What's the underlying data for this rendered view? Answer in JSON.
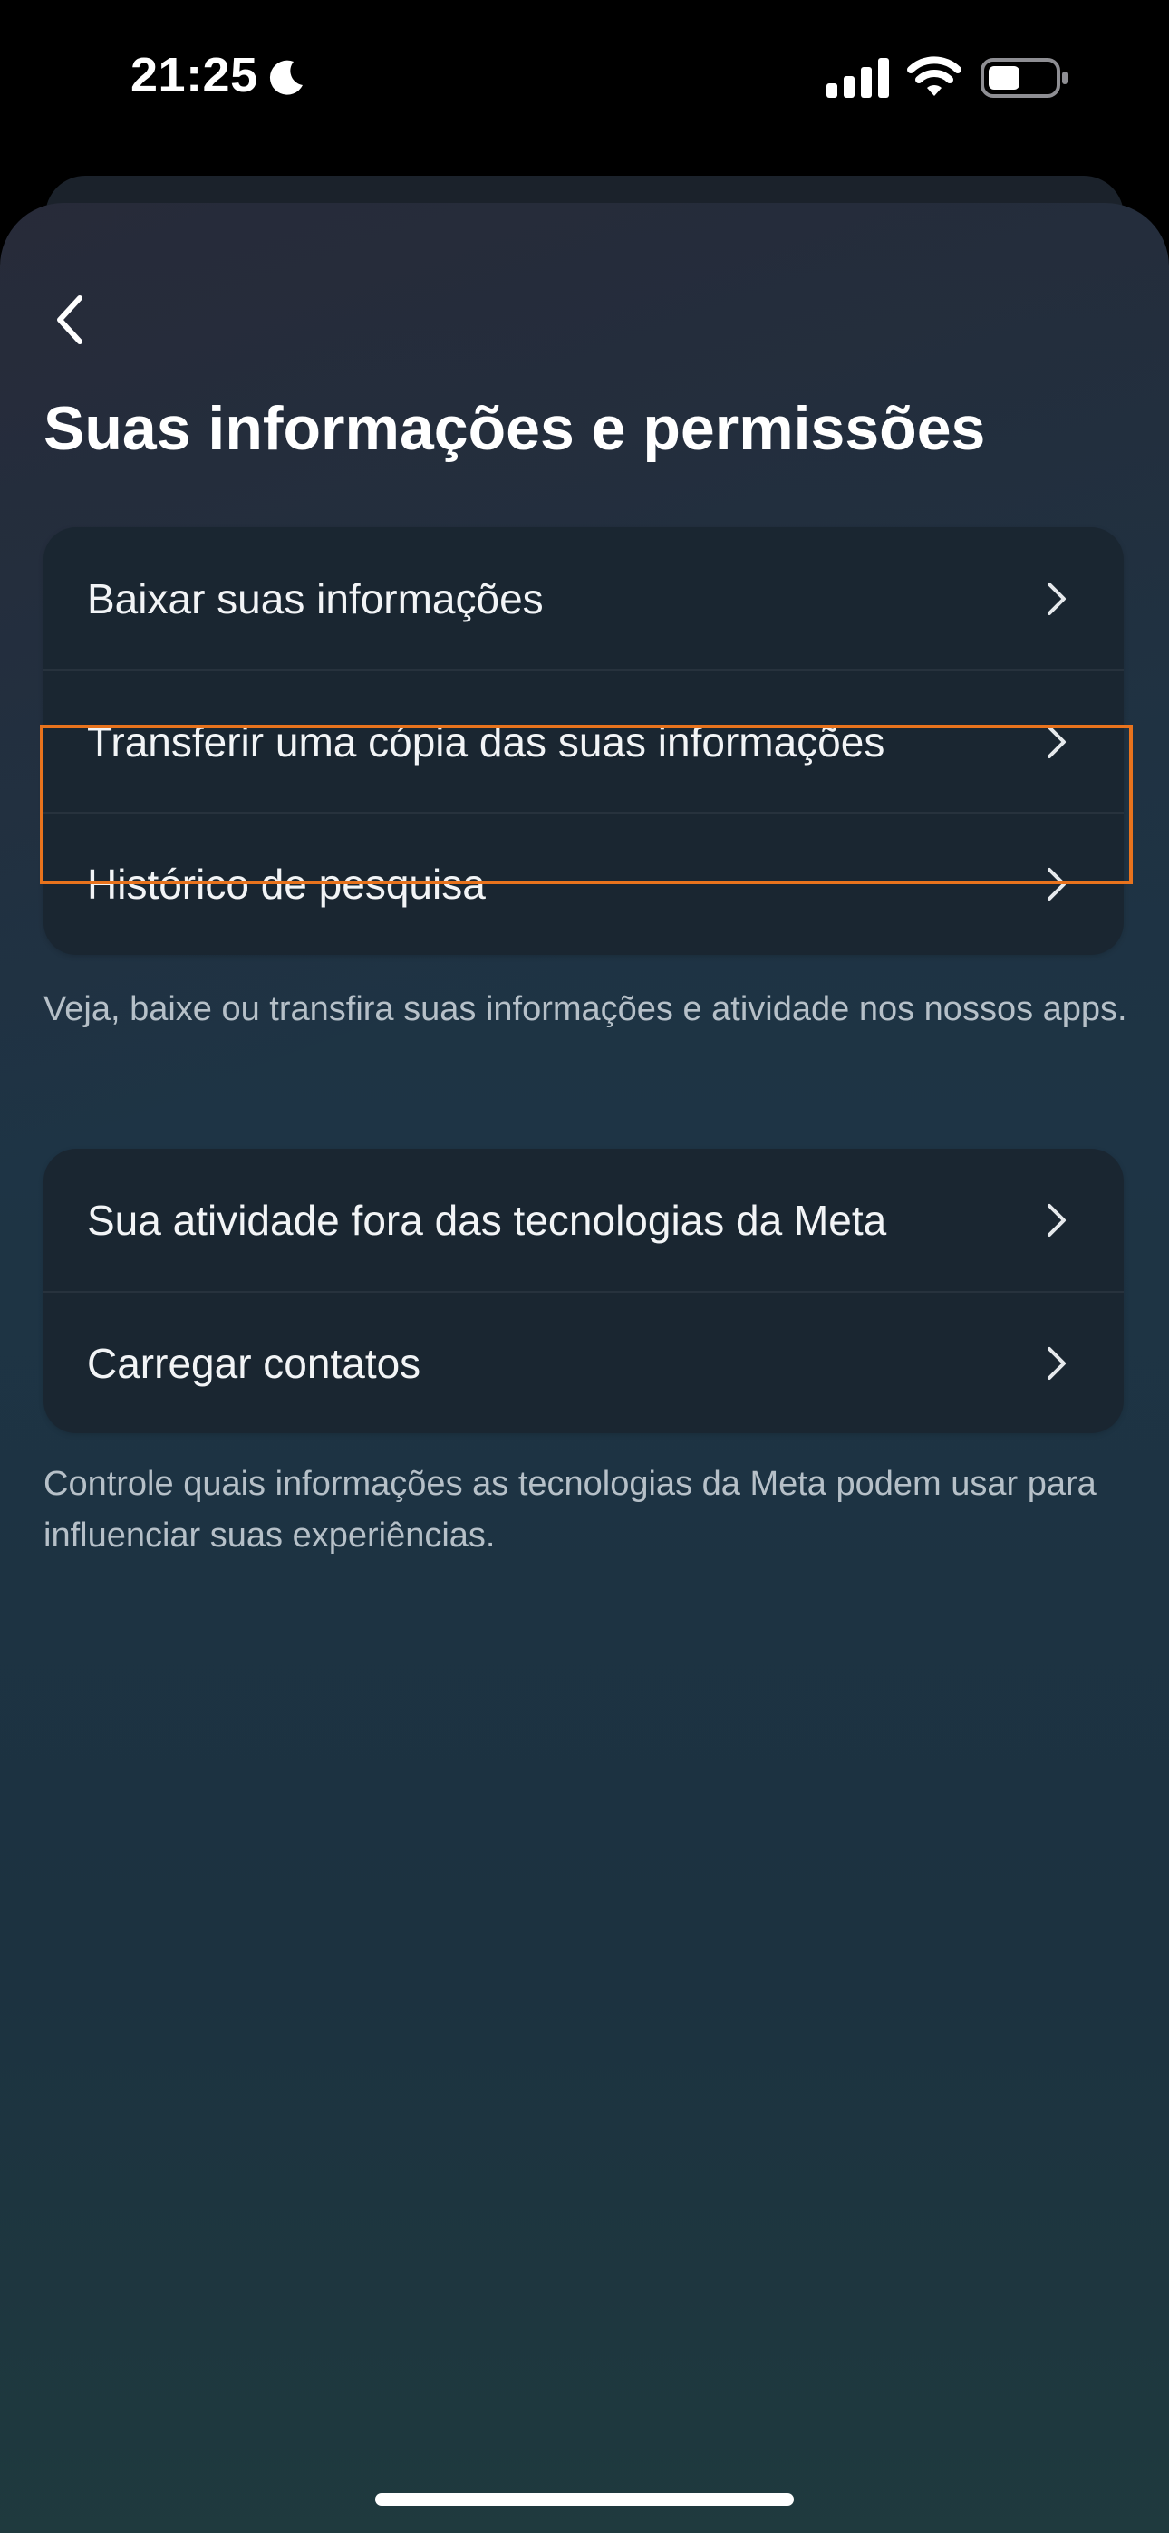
{
  "status_bar": {
    "time": "21:25",
    "icons": [
      "moon-icon",
      "signal-icon",
      "wifi-icon",
      "battery-icon"
    ]
  },
  "page": {
    "title": "Suas informações e permissões",
    "back_icon": "chevron-left-icon"
  },
  "section_1": {
    "items": [
      {
        "label": "Baixar suas informações",
        "highlighted": true
      },
      {
        "label": "Transferir uma cópia das suas informações"
      },
      {
        "label": "Histórico de pesquisa"
      }
    ],
    "caption": "Veja, baixe ou transfira suas informações e atividade nos nossos apps."
  },
  "section_2": {
    "items": [
      {
        "label": "Sua atividade fora das tecnologias da Meta"
      },
      {
        "label": "Carregar contatos"
      }
    ],
    "caption": "Controle quais informações as tecnologias da Meta podem usar para influenciar suas experiências."
  },
  "colors": {
    "highlight_border": "#e8731d",
    "card_background": "#1a2631",
    "caption_text": "#b6c0c8"
  }
}
